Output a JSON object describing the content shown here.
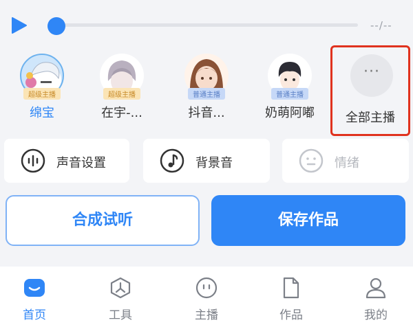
{
  "player": {
    "time": "--/--",
    "progress": 0,
    "accent": "#2f86f6"
  },
  "anchors": [
    {
      "name": "绵宝",
      "badge": "超级主播",
      "badge_type": "gold",
      "selected": true
    },
    {
      "name": "在宇-...",
      "badge": "超级主播",
      "badge_type": "gold",
      "selected": false
    },
    {
      "name": "抖音...",
      "badge": "普通主播",
      "badge_type": "blue",
      "selected": false
    },
    {
      "name": "奶萌阿嘟",
      "badge": "普通主播",
      "badge_type": "blue",
      "selected": false
    }
  ],
  "all_anchors": {
    "label": "全部主播",
    "more": "···"
  },
  "settings": {
    "voice": "声音设置",
    "bgm": "背景音",
    "emotion": "情绪"
  },
  "actions": {
    "preview": "合成试听",
    "save": "保存作品"
  },
  "nav": {
    "home": "首页",
    "tools": "工具",
    "anchors": "主播",
    "works": "作品",
    "me": "我的"
  },
  "colors": {
    "highlight_border": "#e0321e",
    "gold_badge": "#fbe4b5",
    "blue_badge": "#c6d8f7"
  }
}
